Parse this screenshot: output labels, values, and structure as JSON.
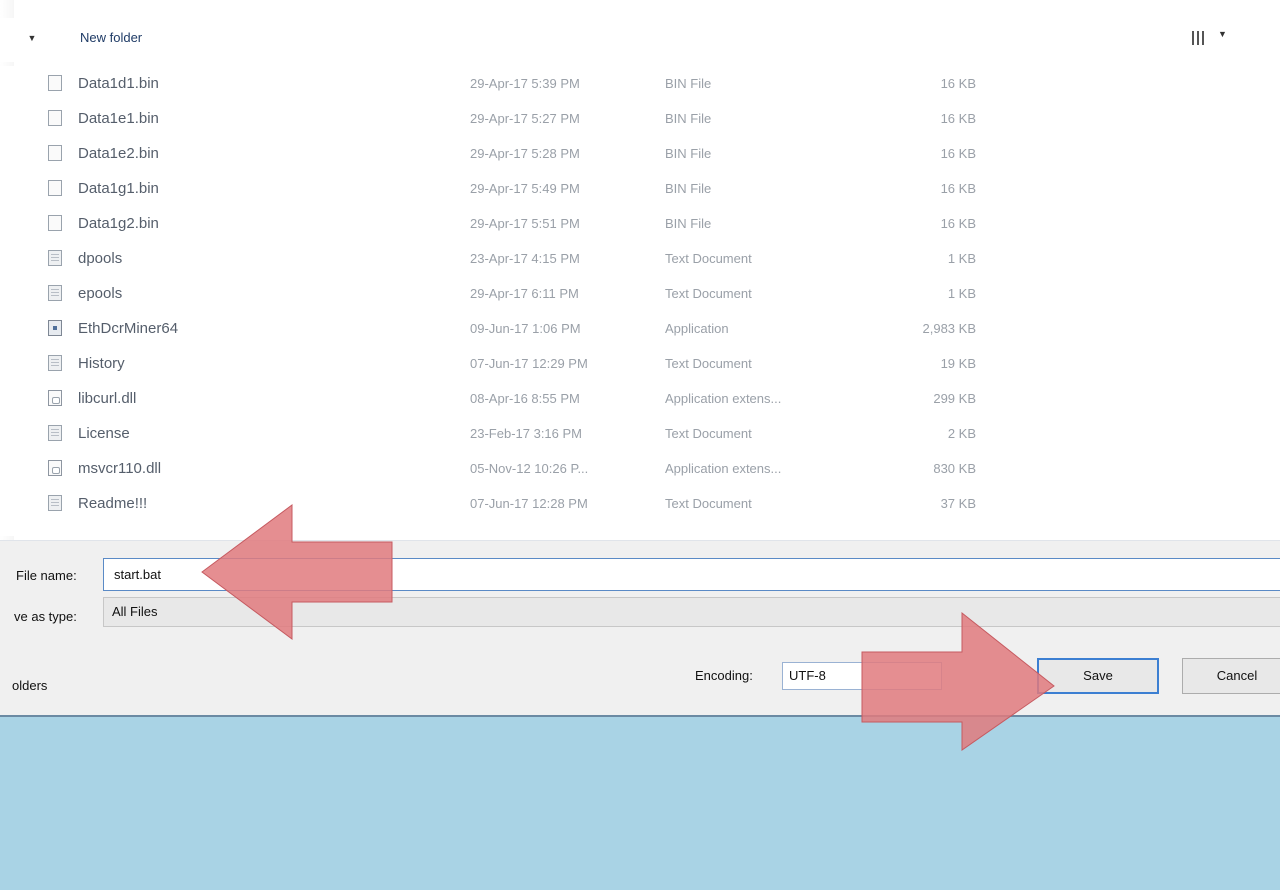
{
  "toolbar": {
    "new_folder_label": "New folder",
    "view_icon": "view-options-icon"
  },
  "files": [
    {
      "name": "Data1d1.bin",
      "date": "29-Apr-17 5:39 PM",
      "type": "BIN File",
      "size": "16 KB",
      "icon": "file-icon"
    },
    {
      "name": "Data1e1.bin",
      "date": "29-Apr-17 5:27 PM",
      "type": "BIN File",
      "size": "16 KB",
      "icon": "file-icon"
    },
    {
      "name": "Data1e2.bin",
      "date": "29-Apr-17 5:28 PM",
      "type": "BIN File",
      "size": "16 KB",
      "icon": "file-icon"
    },
    {
      "name": "Data1g1.bin",
      "date": "29-Apr-17 5:49 PM",
      "type": "BIN File",
      "size": "16 KB",
      "icon": "file-icon"
    },
    {
      "name": "Data1g2.bin",
      "date": "29-Apr-17 5:51 PM",
      "type": "BIN File",
      "size": "16 KB",
      "icon": "file-icon"
    },
    {
      "name": "dpools",
      "date": "23-Apr-17 4:15 PM",
      "type": "Text Document",
      "size": "1 KB",
      "icon": "text-document-icon"
    },
    {
      "name": "epools",
      "date": "29-Apr-17 6:11 PM",
      "type": "Text Document",
      "size": "1 KB",
      "icon": "text-document-icon"
    },
    {
      "name": "EthDcrMiner64",
      "date": "09-Jun-17 1:06 PM",
      "type": "Application",
      "size": "2,983 KB",
      "icon": "application-icon"
    },
    {
      "name": "History",
      "date": "07-Jun-17 12:29 PM",
      "type": "Text Document",
      "size": "19 KB",
      "icon": "text-document-icon"
    },
    {
      "name": "libcurl.dll",
      "date": "08-Apr-16 8:55 PM",
      "type": "Application extens...",
      "size": "299 KB",
      "icon": "dll-icon"
    },
    {
      "name": "License",
      "date": "23-Feb-17 3:16 PM",
      "type": "Text Document",
      "size": "2 KB",
      "icon": "text-document-icon"
    },
    {
      "name": "msvcr110.dll",
      "date": "05-Nov-12 10:26 P...",
      "type": "Application extens...",
      "size": "830 KB",
      "icon": "dll-icon"
    },
    {
      "name": "Readme!!!",
      "date": "07-Jun-17 12:28 PM",
      "type": "Text Document",
      "size": "37 KB",
      "icon": "text-document-icon"
    }
  ],
  "form": {
    "file_name_label": "File name:",
    "file_name_value": "start.bat",
    "save_as_type_label": "ve as type:",
    "save_as_type_value": "All Files",
    "folders_label": "olders",
    "encoding_label": "Encoding:",
    "encoding_value": "UTF-8",
    "save_label": "Save",
    "cancel_label": "Cancel"
  },
  "colors": {
    "annotation_arrow": "#e07a7e",
    "desktop": "#a9d3e5",
    "focus_border": "#3c7fd2"
  }
}
